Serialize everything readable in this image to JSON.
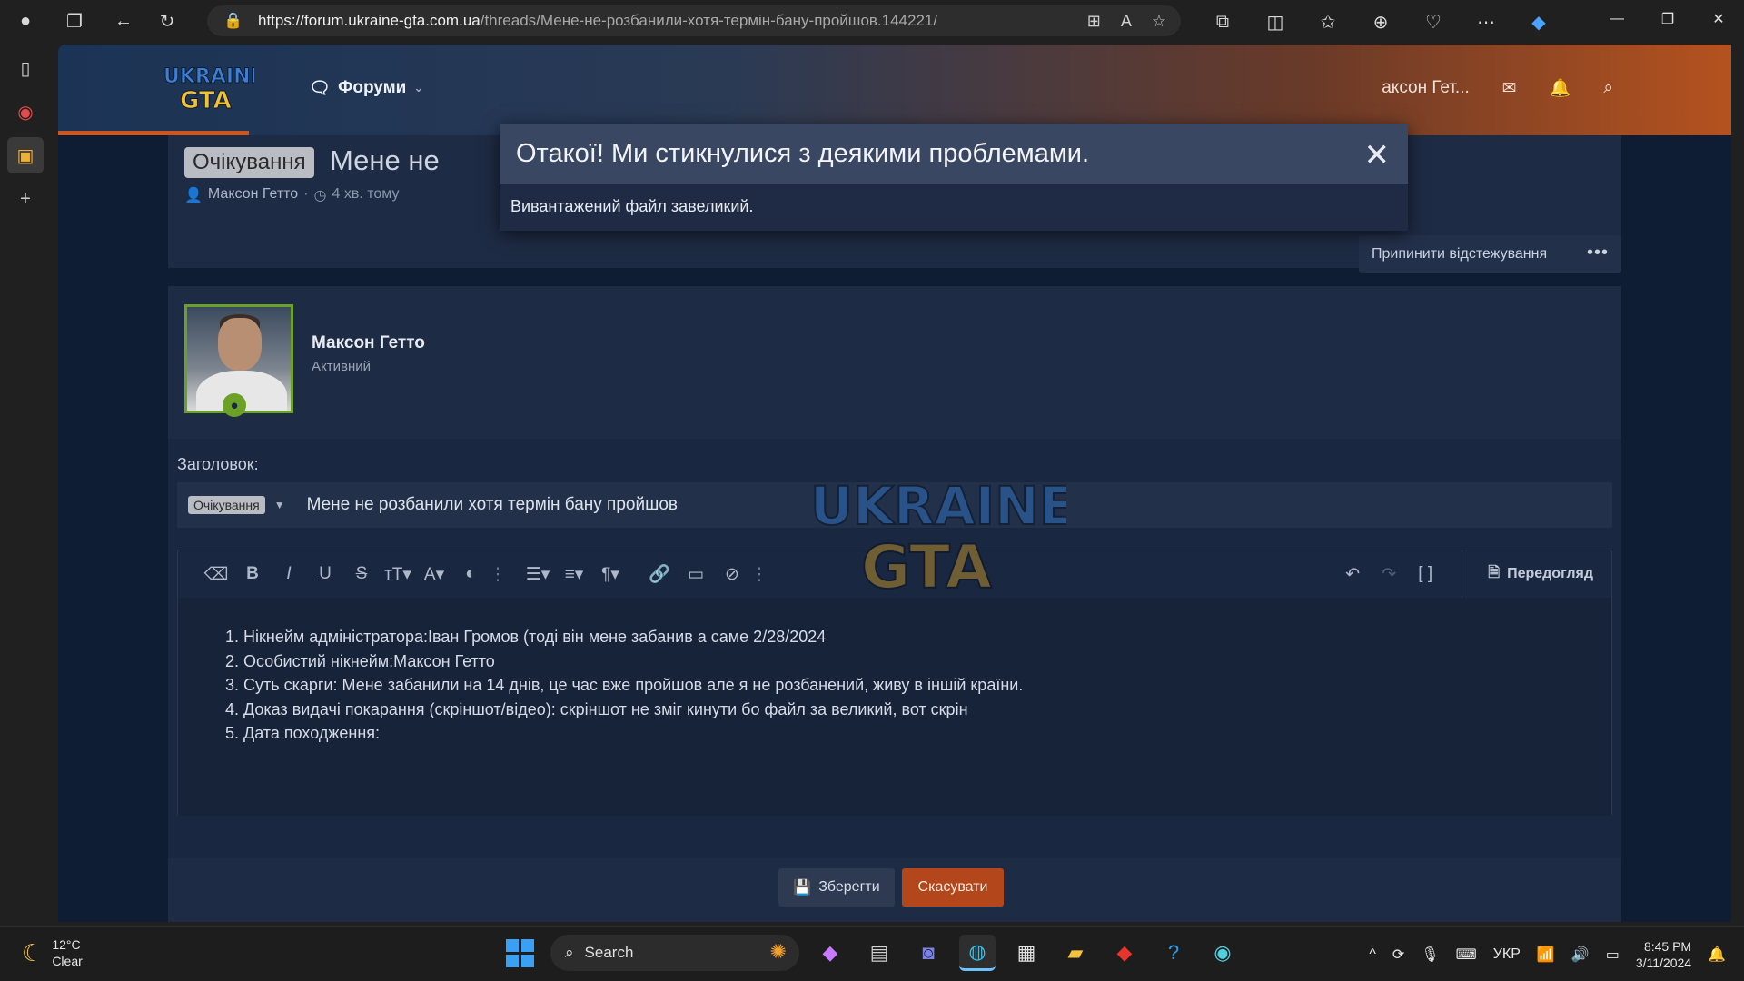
{
  "browser": {
    "url_host": "https://forum.ukraine-gta.com.ua",
    "url_path": "/threads/Мене-не-розбанили-хотя-термін-бану-пройшов.144221/"
  },
  "site": {
    "nav_forums": "Форуми",
    "header_user": "аксон Гет..."
  },
  "thread": {
    "prefix": "Очікування",
    "title_visible": "Мене не",
    "author": "Максон Гетто",
    "time": "4 хв. тому",
    "unwatch_label": "Припинити відстежування",
    "more_label": "•••"
  },
  "post": {
    "username": "Максон Гетто",
    "user_title": "Активний"
  },
  "form": {
    "title_label": "Заголовок:",
    "prefix": "Очікування",
    "title_value": "Мене не розбанили хотя термін бану пройшов",
    "preview_label": "Передогляд",
    "body_lines": [
      "Нікнейм адміністратора:Іван Громов (тоді він мене забанив а саме 2/28/2024",
      "Особистий нікнейм:Максон Гетто",
      "Суть скарги: Мене забанили на 14 днів, це час вже пройшов але я не розбанений, живу в іншій країни.",
      "Доказ видачі покарання (скріншот/відео): скріншот не зміг кинути бо файл за великий, вот скрін",
      "Дата походження:"
    ],
    "save_label": "Зберегти",
    "cancel_label": "Скасувати"
  },
  "overlay": {
    "title": "Отакої! Ми стикнулися з деякими проблемами.",
    "message": "Вивантажений файл завеликий.",
    "close_symbol": "✕"
  },
  "taskbar": {
    "temperature": "12°C",
    "weather": "Clear",
    "search_label": "Search",
    "language": "УКР",
    "time": "8:45 PM",
    "date": "3/11/2024"
  },
  "colors": {
    "accent_orange": "#b3461b",
    "page_bg": "#0f1d34",
    "avatar_border": "#6aa126"
  }
}
